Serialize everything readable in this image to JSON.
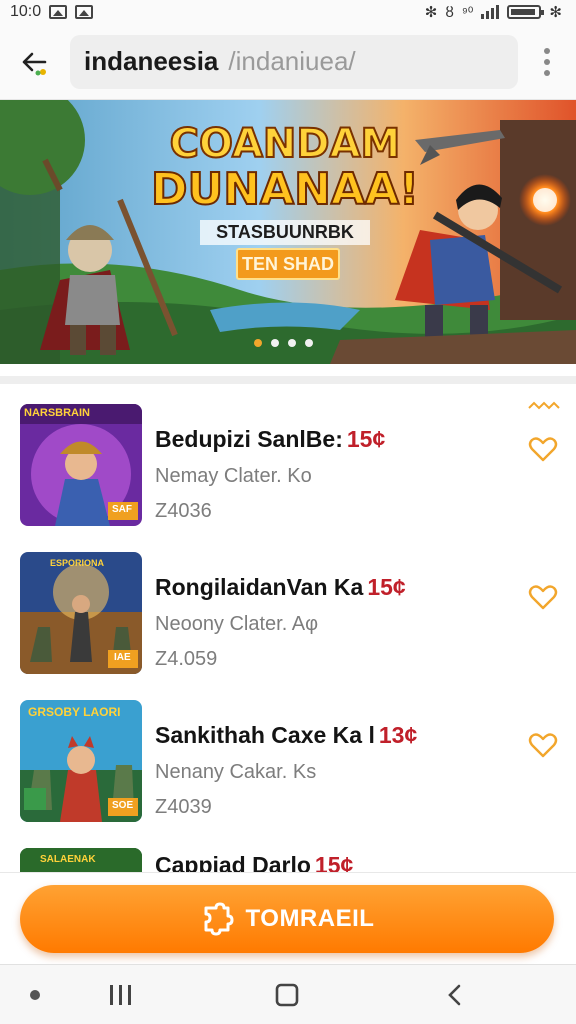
{
  "status_bar": {
    "time": "10:0",
    "signal_text": "⁹⁰"
  },
  "top_bar": {
    "url_main": "indaneesia",
    "url_path": "/indaniuea/"
  },
  "banner": {
    "title_line1": "COANDAM",
    "title_line2": "DUNANAA!",
    "subtitle": "STASBUUNRBK",
    "button_label": "TEN SHAD",
    "active_slide": 1,
    "slide_count": 4
  },
  "items": [
    {
      "title": "Bedupizi SanlBe:",
      "price": "15¢",
      "subtitle": "Nemay Clater. Ko",
      "code": "Z4036",
      "thumb_label": "NARSBRAIN",
      "thumb_badge": "SAF"
    },
    {
      "title": "RongilaidanVan Ka",
      "price": "15¢",
      "subtitle": "Neoony Clater. Aφ",
      "code": "Z4.059",
      "thumb_label": "ESPORIONA",
      "thumb_badge": "IAE"
    },
    {
      "title": "Sankithah Caxe Ka l",
      "price": "13¢",
      "subtitle": "Nenany Cakar. Ks",
      "code": "Z4039",
      "thumb_label": "GRSOBY LAORI",
      "thumb_badge": "SOE"
    },
    {
      "title": "Cappiad Darlo",
      "price": "15¢",
      "subtitle": "",
      "code": "",
      "thumb_label": "SALAENAK",
      "thumb_badge": ""
    }
  ],
  "cta": {
    "label": "TOMRAEIL"
  },
  "colors": {
    "accent": "#ff8a00",
    "price": "#c0202a",
    "heart": "#f2a62c"
  }
}
